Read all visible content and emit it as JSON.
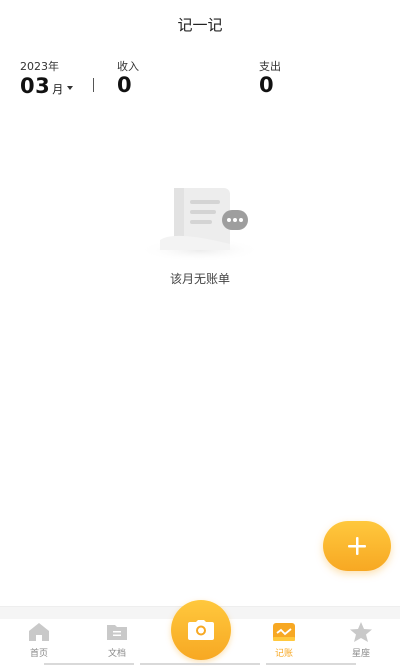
{
  "header": {
    "title": "记一记"
  },
  "summary": {
    "year": "2023年",
    "month": "03",
    "month_unit": "月",
    "income_label": "收入",
    "income_value": "0",
    "expense_label": "支出",
    "expense_value": "0"
  },
  "empty": {
    "text": "该月无账单"
  },
  "fab": {
    "icon": "plus-icon"
  },
  "tabs": [
    {
      "label": "首页",
      "icon": "home-icon",
      "active": false
    },
    {
      "label": "文档",
      "icon": "folder-icon",
      "active": false
    },
    {
      "label": "记账",
      "icon": "ledger-icon",
      "active": true
    },
    {
      "label": "星座",
      "icon": "star-icon",
      "active": false
    }
  ],
  "camera": {
    "icon": "camera-icon"
  },
  "colors": {
    "accent": "#f7a823",
    "accent_light": "#ffc83d",
    "text": "#222222",
    "muted": "#888888"
  }
}
